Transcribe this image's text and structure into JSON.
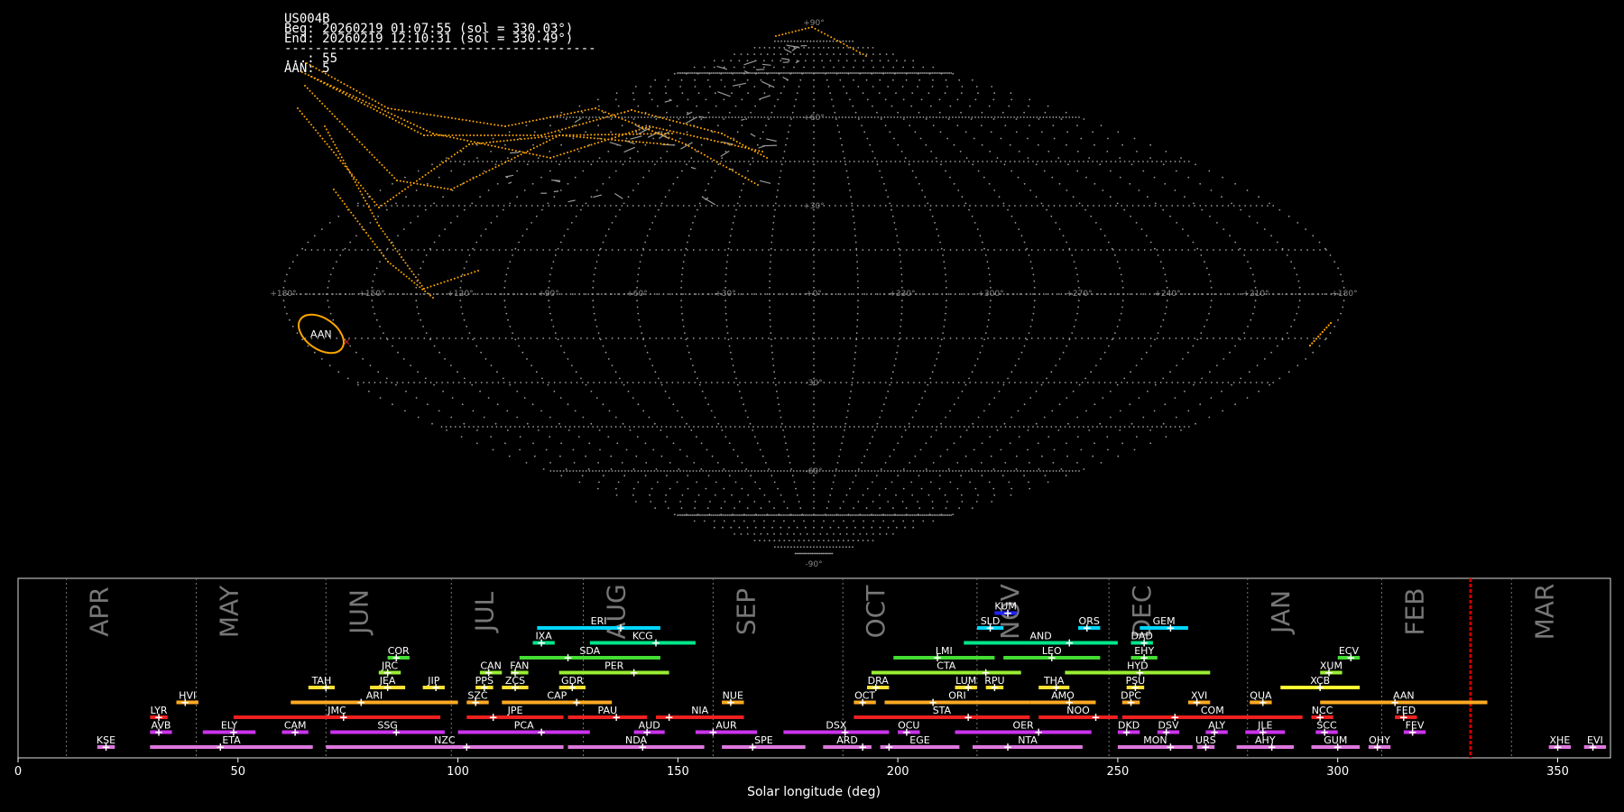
{
  "info": {
    "station": "US004B",
    "begin": "Beg: 20260219 01:07:55 (sol = 330.03°)",
    "end": "End: 20260219 12:10:31 (sol = 330.49°)",
    "separator": "-----------------------------------------",
    "sporadic": "...: 55",
    "aan": "AAN: 5"
  },
  "colors": {
    "background": "#000000",
    "grid": "#9a9a9a",
    "meteor_orange": "#ffa500",
    "sporadic_gray": "#9a9a9a",
    "marker_red": "#ff3030",
    "current_sol_line": "#cc0000"
  },
  "chart_data": [
    {
      "type": "scatter",
      "projection": "sinusoidal sky map",
      "lon_ticks": [
        "+180°",
        "+150°",
        "+120°",
        "+90°",
        "+60°",
        "+30°",
        "+0°",
        "+330°",
        "+300°",
        "+270°",
        "+240°",
        "+210°",
        "+180°"
      ],
      "lat_ticks": [
        {
          "lat": 90,
          "label": "+90°"
        },
        {
          "lat": 60,
          "label": "+60°"
        },
        {
          "lat": 30,
          "label": "+30°"
        },
        {
          "lat": -30,
          "label": "-30°"
        },
        {
          "lat": -60,
          "label": "-60°"
        },
        {
          "lat": -90,
          "label": "-90°"
        }
      ],
      "radiant": {
        "label": "AAN",
        "ra": 193,
        "dec": -20
      },
      "grid": true
    },
    {
      "type": "bar",
      "title": "",
      "xlabel": "Solar longitude (deg)",
      "xlim": [
        0,
        362
      ],
      "xticks": [
        0,
        50,
        100,
        150,
        200,
        250,
        300,
        350
      ],
      "current_sol": 330.2,
      "months": [
        {
          "name": "APR",
          "start": 11,
          "end": 40.5
        },
        {
          "name": "MAY",
          "start": 40.5,
          "end": 70
        },
        {
          "name": "JUN",
          "start": 70,
          "end": 98.5
        },
        {
          "name": "JUL",
          "start": 98.5,
          "end": 128.5
        },
        {
          "name": "AUG",
          "start": 128.5,
          "end": 158
        },
        {
          "name": "SEP",
          "start": 158,
          "end": 187.5
        },
        {
          "name": "OCT",
          "start": 187.5,
          "end": 248
        },
        {
          "name": "NOV",
          "start": 218,
          "end": 248
        },
        {
          "name": "DEC",
          "start": 248,
          "end": 279.5
        },
        {
          "name": "JAN",
          "start": 279.5,
          "end": 310
        },
        {
          "name": "FEB",
          "start": 310,
          "end": 339.5
        },
        {
          "name": "MAR",
          "start": 339.5,
          "end": 371
        }
      ],
      "showers": [
        {
          "code": "KUM",
          "start": 222,
          "end": 227,
          "peak": 225,
          "row": 10,
          "color": "#2222ff"
        },
        {
          "code": "ERI",
          "start": 118,
          "end": 146,
          "peak": 137,
          "row": 9,
          "color": "#00d7ff"
        },
        {
          "code": "SLD",
          "start": 218,
          "end": 224,
          "peak": 221,
          "row": 9,
          "color": "#00d7ff"
        },
        {
          "code": "ORS",
          "start": 241,
          "end": 246,
          "peak": 243,
          "row": 9,
          "color": "#00d7ff"
        },
        {
          "code": "GEM",
          "start": 255,
          "end": 266,
          "peak": 262,
          "row": 9,
          "color": "#00d7ff"
        },
        {
          "code": "IXA",
          "start": 117,
          "end": 122,
          "peak": 119,
          "row": 8,
          "color": "#00e68a"
        },
        {
          "code": "KCG",
          "start": 130,
          "end": 154,
          "peak": 145,
          "row": 8,
          "color": "#00e68a"
        },
        {
          "code": "AND",
          "start": 215,
          "end": 250,
          "peak": 239,
          "row": 8,
          "color": "#00e68a"
        },
        {
          "code": "DAD",
          "start": 253,
          "end": 258,
          "peak": 256,
          "row": 8,
          "color": "#00e68a"
        },
        {
          "code": "COR",
          "start": 84,
          "end": 89,
          "peak": 86,
          "row": 7,
          "color": "#44dd33"
        },
        {
          "code": "SDA",
          "start": 114,
          "end": 146,
          "peak": 125,
          "row": 7,
          "color": "#44dd33"
        },
        {
          "code": "LMI",
          "start": 199,
          "end": 222,
          "peak": 209,
          "row": 7,
          "color": "#44dd33"
        },
        {
          "code": "LEO",
          "start": 224,
          "end": 246,
          "peak": 235,
          "row": 7,
          "color": "#44dd33"
        },
        {
          "code": "EHY",
          "start": 253,
          "end": 259,
          "peak": 256,
          "row": 7,
          "color": "#44dd33"
        },
        {
          "code": "ECV",
          "start": 300,
          "end": 305,
          "peak": 303,
          "row": 7,
          "color": "#44dd33"
        },
        {
          "code": "JRC",
          "start": 82,
          "end": 87,
          "peak": 84,
          "row": 6,
          "color": "#99ee33"
        },
        {
          "code": "CAN",
          "start": 105,
          "end": 110,
          "peak": 107,
          "row": 6,
          "color": "#99ee33"
        },
        {
          "code": "FAN",
          "start": 112,
          "end": 116,
          "peak": 113,
          "row": 6,
          "color": "#99ee33"
        },
        {
          "code": "PER",
          "start": 123,
          "end": 148,
          "peak": 140,
          "row": 6,
          "color": "#99ee33"
        },
        {
          "code": "CTA",
          "start": 194,
          "end": 228,
          "peak": 220,
          "row": 6,
          "color": "#99ee33"
        },
        {
          "code": "HYD",
          "start": 238,
          "end": 271,
          "peak": 255,
          "row": 6,
          "color": "#99ee33"
        },
        {
          "code": "XUM",
          "start": 296,
          "end": 301,
          "peak": 298,
          "row": 6,
          "color": "#99ee33"
        },
        {
          "code": "TAH",
          "start": 66,
          "end": 72,
          "peak": 70,
          "row": 5,
          "color": "#ffe033"
        },
        {
          "code": "JEA",
          "start": 80,
          "end": 88,
          "peak": 84,
          "row": 5,
          "color": "#ffe033"
        },
        {
          "code": "JIP",
          "start": 92,
          "end": 97,
          "peak": 95,
          "row": 5,
          "color": "#ffe033"
        },
        {
          "code": "PPS",
          "start": 104,
          "end": 108,
          "peak": 106,
          "row": 5,
          "color": "#ffe033"
        },
        {
          "code": "ZCS",
          "start": 110,
          "end": 116,
          "peak": 113,
          "row": 5,
          "color": "#ffe033"
        },
        {
          "code": "GDR",
          "start": 123,
          "end": 129,
          "peak": 126,
          "row": 5,
          "color": "#ffe033"
        },
        {
          "code": "DRA",
          "start": 193,
          "end": 198,
          "peak": 195,
          "row": 5,
          "color": "#ffe033"
        },
        {
          "code": "LUM",
          "start": 213,
          "end": 218,
          "peak": 216,
          "row": 5,
          "color": "#ffe033"
        },
        {
          "code": "RPU",
          "start": 220,
          "end": 224,
          "peak": 222,
          "row": 5,
          "color": "#ffe033"
        },
        {
          "code": "THA",
          "start": 232,
          "end": 239,
          "peak": 236,
          "row": 5,
          "color": "#ffe033"
        },
        {
          "code": "PSU",
          "start": 252,
          "end": 256,
          "peak": 254,
          "row": 5,
          "color": "#ffe033"
        },
        {
          "code": "XCB",
          "start": 287,
          "end": 305,
          "peak": 296,
          "row": 5,
          "color": "#ffff33"
        },
        {
          "code": "HVI",
          "start": 36,
          "end": 41,
          "peak": 38,
          "row": 4,
          "color": "#ffaa22"
        },
        {
          "code": "ARI",
          "start": 62,
          "end": 100,
          "peak": 78,
          "row": 4,
          "color": "#ffaa22"
        },
        {
          "code": "SZC",
          "start": 102,
          "end": 107,
          "peak": 104,
          "row": 4,
          "color": "#ffaa22"
        },
        {
          "code": "CAP",
          "start": 110,
          "end": 135,
          "peak": 127,
          "row": 4,
          "color": "#ffaa22"
        },
        {
          "code": "NUE",
          "start": 160,
          "end": 165,
          "peak": 162,
          "row": 4,
          "color": "#ffaa22"
        },
        {
          "code": "OCT",
          "start": 190,
          "end": 195,
          "peak": 192,
          "row": 4,
          "color": "#ffaa22"
        },
        {
          "code": "ORI",
          "start": 197,
          "end": 230,
          "peak": 208,
          "row": 4,
          "color": "#ffaa22"
        },
        {
          "code": "AMO",
          "start": 230,
          "end": 245,
          "peak": 239,
          "row": 4,
          "color": "#ffaa22"
        },
        {
          "code": "DPC",
          "start": 251,
          "end": 255,
          "peak": 253,
          "row": 4,
          "color": "#ffaa22"
        },
        {
          "code": "XVI",
          "start": 266,
          "end": 271,
          "peak": 268,
          "row": 4,
          "color": "#ffaa22"
        },
        {
          "code": "QUA",
          "start": 280,
          "end": 285,
          "peak": 283,
          "row": 4,
          "color": "#ffaa22"
        },
        {
          "code": "AAN",
          "start": 296,
          "end": 334,
          "peak": 313,
          "row": 4,
          "color": "#ffaa22"
        },
        {
          "code": "LYR",
          "start": 30,
          "end": 34,
          "peak": 32,
          "row": 3,
          "color": "#ee2020"
        },
        {
          "code": "JMC",
          "start": 49,
          "end": 96,
          "peak": 74,
          "row": 3,
          "color": "#ee2020"
        },
        {
          "code": "JPE",
          "start": 102,
          "end": 124,
          "peak": 108,
          "row": 3,
          "color": "#ee2020"
        },
        {
          "code": "PAU",
          "start": 125,
          "end": 143,
          "peak": 136,
          "row": 3,
          "color": "#ee2020"
        },
        {
          "code": "NIA",
          "start": 145,
          "end": 165,
          "peak": 148,
          "row": 3,
          "color": "#ee2020"
        },
        {
          "code": "STA",
          "start": 190,
          "end": 230,
          "peak": 216,
          "row": 3,
          "color": "#ee2020"
        },
        {
          "code": "NOO",
          "start": 232,
          "end": 250,
          "peak": 245,
          "row": 3,
          "color": "#ee2020"
        },
        {
          "code": "COM",
          "start": 251,
          "end": 292,
          "peak": 263,
          "row": 3,
          "color": "#ee2020"
        },
        {
          "code": "NCC",
          "start": 294,
          "end": 299,
          "peak": 296,
          "row": 3,
          "color": "#ee2020"
        },
        {
          "code": "FED",
          "start": 313,
          "end": 318,
          "peak": 315,
          "row": 3,
          "color": "#ee2020"
        },
        {
          "code": "AVB",
          "start": 30,
          "end": 35,
          "peak": 32,
          "row": 2,
          "color": "#cc33ee"
        },
        {
          "code": "ELY",
          "start": 42,
          "end": 54,
          "peak": 49,
          "row": 2,
          "color": "#cc33ee"
        },
        {
          "code": "CAM",
          "start": 60,
          "end": 66,
          "peak": 63,
          "row": 2,
          "color": "#cc33ee"
        },
        {
          "code": "SSG",
          "start": 71,
          "end": 97,
          "peak": 86,
          "row": 2,
          "color": "#cc33ee"
        },
        {
          "code": "PCA",
          "start": 100,
          "end": 130,
          "peak": 119,
          "row": 2,
          "color": "#cc33ee"
        },
        {
          "code": "AUD",
          "start": 140,
          "end": 147,
          "peak": 143,
          "row": 2,
          "color": "#cc33ee"
        },
        {
          "code": "AUR",
          "start": 154,
          "end": 168,
          "peak": 158,
          "row": 2,
          "color": "#cc33ee"
        },
        {
          "code": "DSX",
          "start": 174,
          "end": 198,
          "peak": 188,
          "row": 2,
          "color": "#cc33ee"
        },
        {
          "code": "OCU",
          "start": 200,
          "end": 205,
          "peak": 202,
          "row": 2,
          "color": "#cc33ee"
        },
        {
          "code": "OER",
          "start": 213,
          "end": 244,
          "peak": 232,
          "row": 2,
          "color": "#cc33ee"
        },
        {
          "code": "DKD",
          "start": 250,
          "end": 255,
          "peak": 252,
          "row": 2,
          "color": "#cc33ee"
        },
        {
          "code": "DSV",
          "start": 259,
          "end": 264,
          "peak": 261,
          "row": 2,
          "color": "#cc33ee"
        },
        {
          "code": "ALY",
          "start": 270,
          "end": 275,
          "peak": 272,
          "row": 2,
          "color": "#cc33ee"
        },
        {
          "code": "JLE",
          "start": 279,
          "end": 288,
          "peak": 283,
          "row": 2,
          "color": "#cc33ee"
        },
        {
          "code": "SCC",
          "start": 295,
          "end": 300,
          "peak": 297,
          "row": 2,
          "color": "#cc33ee"
        },
        {
          "code": "FEV",
          "start": 315,
          "end": 320,
          "peak": 317,
          "row": 2,
          "color": "#cc33ee"
        },
        {
          "code": "KSE",
          "start": 18,
          "end": 22,
          "peak": 20,
          "row": 1,
          "color": "#dd77dd"
        },
        {
          "code": "ETA",
          "start": 30,
          "end": 67,
          "peak": 46,
          "row": 1,
          "color": "#dd77dd"
        },
        {
          "code": "NZC",
          "start": 70,
          "end": 124,
          "peak": 102,
          "row": 1,
          "color": "#dd77dd"
        },
        {
          "code": "NDA",
          "start": 125,
          "end": 156,
          "peak": 142,
          "row": 1,
          "color": "#dd77dd"
        },
        {
          "code": "SPE",
          "start": 160,
          "end": 179,
          "peak": 167,
          "row": 1,
          "color": "#dd77dd"
        },
        {
          "code": "ARD",
          "start": 183,
          "end": 194,
          "peak": 192,
          "row": 1,
          "color": "#dd77dd"
        },
        {
          "code": "EGE",
          "start": 196,
          "end": 214,
          "peak": 198,
          "row": 1,
          "color": "#dd77dd"
        },
        {
          "code": "NTA",
          "start": 217,
          "end": 242,
          "peak": 225,
          "row": 1,
          "color": "#dd77dd"
        },
        {
          "code": "MON",
          "start": 250,
          "end": 267,
          "peak": 262,
          "row": 1,
          "color": "#dd77dd"
        },
        {
          "code": "URS",
          "start": 268,
          "end": 272,
          "peak": 270,
          "row": 1,
          "color": "#dd77dd"
        },
        {
          "code": "AHY",
          "start": 277,
          "end": 290,
          "peak": 285,
          "row": 1,
          "color": "#dd77dd"
        },
        {
          "code": "GUM",
          "start": 294,
          "end": 305,
          "peak": 300,
          "row": 1,
          "color": "#dd77dd"
        },
        {
          "code": "OHY",
          "start": 307,
          "end": 312,
          "peak": 309,
          "row": 1,
          "color": "#dd77dd"
        },
        {
          "code": "XHE",
          "start": 348,
          "end": 353,
          "peak": 350,
          "row": 1,
          "color": "#dd77dd"
        },
        {
          "code": "EVI",
          "start": 356,
          "end": 361,
          "peak": 358,
          "row": 1,
          "color": "#dd77dd"
        }
      ]
    }
  ]
}
